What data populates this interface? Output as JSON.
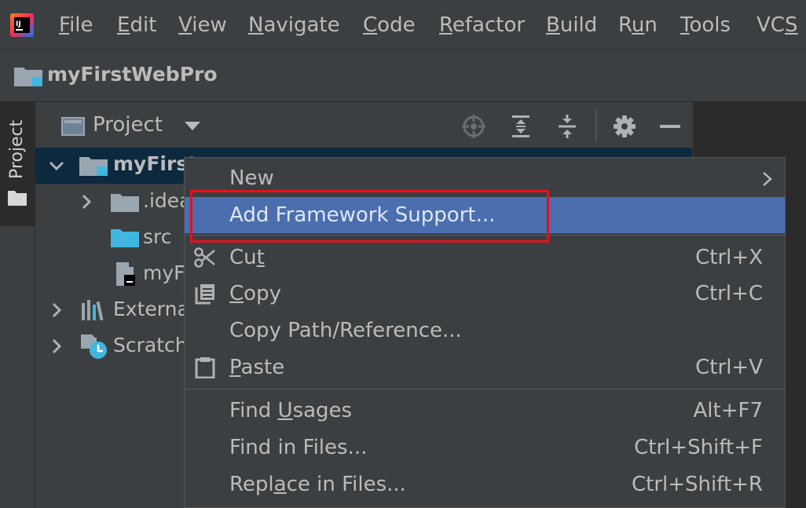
{
  "menubar": {
    "items": [
      {
        "mnemonic": "F",
        "rest": "ile"
      },
      {
        "mnemonic": "E",
        "rest": "dit"
      },
      {
        "mnemonic": "V",
        "rest": "iew"
      },
      {
        "mnemonic": "N",
        "rest": "avigate"
      },
      {
        "mnemonic": "C",
        "rest": "ode"
      },
      {
        "mnemonic": "R",
        "rest": "efactor"
      },
      {
        "mnemonic": "B",
        "rest": "uild"
      },
      {
        "pre": "R",
        "mnemonic": "u",
        "rest": "n"
      },
      {
        "mnemonic": "T",
        "rest": "ools"
      },
      {
        "pre": "VC",
        "mnemonic": "S",
        "rest": ""
      }
    ]
  },
  "navbar": {
    "project_name": "myFirstWebPro"
  },
  "sidestripe": {
    "tab_label": "Project"
  },
  "toolwindow": {
    "view_label": "Project",
    "tree": [
      {
        "label": "myFirst",
        "bold": true
      },
      {
        "label": ".idea"
      },
      {
        "label": "src"
      },
      {
        "label": "myF"
      },
      {
        "label": "Externa"
      },
      {
        "label": "Scratch"
      }
    ]
  },
  "context_menu": {
    "items": [
      {
        "label": "New"
      },
      {
        "label": "Add Framework Support..."
      },
      {
        "pre": "Cu",
        "mnemonic": "t",
        "post": "",
        "shortcut": "Ctrl+X"
      },
      {
        "pre": "",
        "mnemonic": "C",
        "post": "opy",
        "shortcut": "Ctrl+C"
      },
      {
        "label": "Copy Path/Reference..."
      },
      {
        "pre": "",
        "mnemonic": "P",
        "post": "aste",
        "shortcut": "Ctrl+V"
      },
      {
        "pre": "Find ",
        "mnemonic": "U",
        "post": "sages",
        "shortcut": "Alt+F7"
      },
      {
        "label": "Find in Files...",
        "shortcut": "Ctrl+Shift+F"
      },
      {
        "pre": "Repl",
        "mnemonic": "a",
        "post": "ce in Files...",
        "shortcut": "Ctrl+Shift+R"
      }
    ]
  },
  "colors": {
    "background": "#3c3f41",
    "selection_highlight": "#4b6eaf",
    "annotation_box": "#e8101a",
    "tree_selection": "#0d293e"
  },
  "icons": [
    "intellij-logo-icon",
    "project-folder-icon",
    "project-view-icon",
    "locate-icon",
    "expand-all-icon",
    "collapse-all-icon",
    "gear-icon",
    "minimize-icon",
    "folder-icon",
    "source-folder-icon",
    "module-file-icon",
    "libraries-icon",
    "scratches-icon",
    "scissors-icon",
    "copy-icon",
    "clipboard-icon",
    "chevron-right-icon",
    "chevron-down-icon"
  ]
}
